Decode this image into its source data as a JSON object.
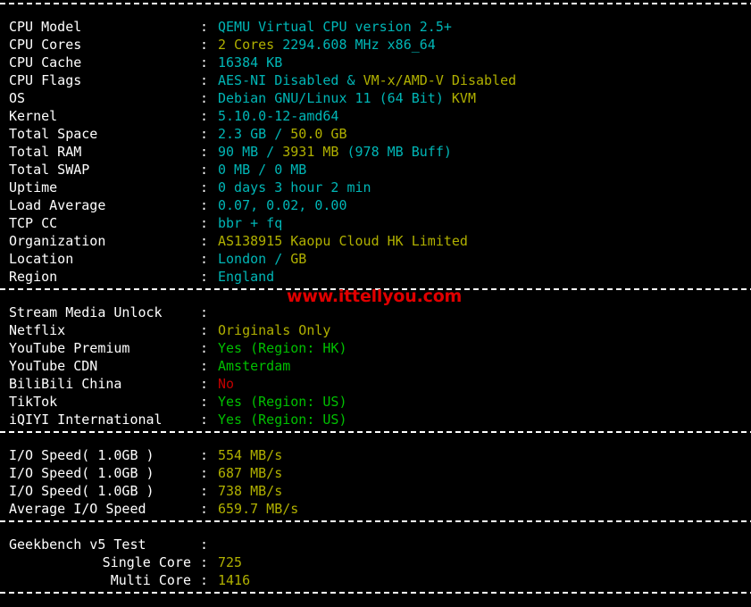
{
  "terminal": {
    "background_color": "#000000",
    "palette": {
      "label": "#ffffff",
      "cyan": "#00b6b6",
      "yellow": "#b0b000",
      "green": "#00c000",
      "red": "#c00000",
      "watermark": "#e00000"
    },
    "watermark": "www.ittellyou.com"
  },
  "sections": [
    {
      "name": "system-info",
      "rows": [
        {
          "label": "CPU Model",
          "colon": ":",
          "parts": [
            {
              "text": "QEMU Virtual CPU version 2.5+",
              "color": "cyan"
            }
          ]
        },
        {
          "label": "CPU Cores",
          "colon": ":",
          "parts": [
            {
              "text": "2 Cores",
              "color": "yellow"
            },
            {
              "text": " 2294.608 MHz x86_64",
              "color": "cyan"
            }
          ]
        },
        {
          "label": "CPU Cache",
          "colon": ":",
          "parts": [
            {
              "text": "16384 KB",
              "color": "cyan"
            }
          ]
        },
        {
          "label": "CPU Flags",
          "colon": ":",
          "parts": [
            {
              "text": "AES-NI Disabled",
              "color": "cyan"
            },
            {
              "text": " & ",
              "color": "cyan"
            },
            {
              "text": "VM-x/AMD-V Disabled",
              "color": "yellow"
            }
          ]
        },
        {
          "label": "OS",
          "colon": ":",
          "parts": [
            {
              "text": "Debian GNU/Linux 11 (64 Bit) ",
              "color": "cyan"
            },
            {
              "text": "KVM",
              "color": "yellow"
            }
          ]
        },
        {
          "label": "Kernel",
          "colon": ":",
          "parts": [
            {
              "text": "5.10.0-12-amd64",
              "color": "cyan"
            }
          ]
        },
        {
          "label": "Total Space",
          "colon": ":",
          "parts": [
            {
              "text": "2.3 GB / ",
              "color": "cyan"
            },
            {
              "text": "50.0 GB",
              "color": "yellow"
            }
          ]
        },
        {
          "label": "Total RAM",
          "colon": ":",
          "parts": [
            {
              "text": "90 MB / ",
              "color": "cyan"
            },
            {
              "text": "3931 MB",
              "color": "yellow"
            },
            {
              "text": " (978 MB Buff)",
              "color": "cyan"
            }
          ]
        },
        {
          "label": "Total SWAP",
          "colon": ":",
          "parts": [
            {
              "text": "0 MB / 0 MB",
              "color": "cyan"
            }
          ]
        },
        {
          "label": "Uptime",
          "colon": ":",
          "parts": [
            {
              "text": "0 days 3 hour 2 min",
              "color": "cyan"
            }
          ]
        },
        {
          "label": "Load Average",
          "colon": ":",
          "parts": [
            {
              "text": "0.07, 0.02, 0.00",
              "color": "cyan"
            }
          ]
        },
        {
          "label": "TCP CC",
          "colon": ":",
          "parts": [
            {
              "text": "bbr + fq",
              "color": "cyan"
            }
          ]
        },
        {
          "label": "Organization",
          "colon": ":",
          "parts": [
            {
              "text": "AS138915 Kaopu Cloud HK Limited",
              "color": "yellow"
            }
          ]
        },
        {
          "label": "Location",
          "colon": ":",
          "parts": [
            {
              "text": "London / ",
              "color": "cyan"
            },
            {
              "text": "GB",
              "color": "yellow"
            }
          ]
        },
        {
          "label": "Region",
          "colon": ":",
          "parts": [
            {
              "text": "England",
              "color": "cyan"
            }
          ]
        }
      ]
    },
    {
      "name": "stream-media-unlock",
      "rows": [
        {
          "label": "Stream Media Unlock",
          "colon": ":",
          "parts": []
        },
        {
          "label": "Netflix",
          "colon": ":",
          "parts": [
            {
              "text": "Originals Only",
              "color": "yellow"
            }
          ]
        },
        {
          "label": "YouTube Premium",
          "colon": ":",
          "parts": [
            {
              "text": "Yes (Region: HK)",
              "color": "green"
            }
          ]
        },
        {
          "label": "YouTube CDN",
          "colon": ":",
          "parts": [
            {
              "text": "Amsterdam",
              "color": "green"
            }
          ]
        },
        {
          "label": "BiliBili China",
          "colon": ":",
          "parts": [
            {
              "text": "No",
              "color": "red"
            }
          ]
        },
        {
          "label": "TikTok",
          "colon": ":",
          "parts": [
            {
              "text": "Yes (Region: US)",
              "color": "green"
            }
          ]
        },
        {
          "label": "iQIYI International",
          "colon": ":",
          "parts": [
            {
              "text": "Yes (Region: US)",
              "color": "green"
            }
          ]
        }
      ]
    },
    {
      "name": "io-speed",
      "rows": [
        {
          "label": "I/O Speed( 1.0GB )",
          "colon": ":",
          "parts": [
            {
              "text": "554 MB/s",
              "color": "yellow"
            }
          ]
        },
        {
          "label": "I/O Speed( 1.0GB )",
          "colon": ":",
          "parts": [
            {
              "text": "687 MB/s",
              "color": "yellow"
            }
          ]
        },
        {
          "label": "I/O Speed( 1.0GB )",
          "colon": ":",
          "parts": [
            {
              "text": "738 MB/s",
              "color": "yellow"
            }
          ]
        },
        {
          "label": "Average I/O Speed",
          "colon": ":",
          "parts": [
            {
              "text": "659.7 MB/s",
              "color": "yellow"
            }
          ]
        }
      ]
    },
    {
      "name": "geekbench-v5",
      "rows": [
        {
          "label": "Geekbench v5 Test",
          "colon": ":",
          "parts": []
        },
        {
          "label": "Single Core",
          "indent": true,
          "colon": ":",
          "parts": [
            {
              "text": "725",
              "color": "yellow"
            }
          ]
        },
        {
          "label": "Multi Core",
          "indent": true,
          "colon": ":",
          "parts": [
            {
              "text": "1416",
              "color": "yellow"
            }
          ]
        }
      ]
    }
  ]
}
